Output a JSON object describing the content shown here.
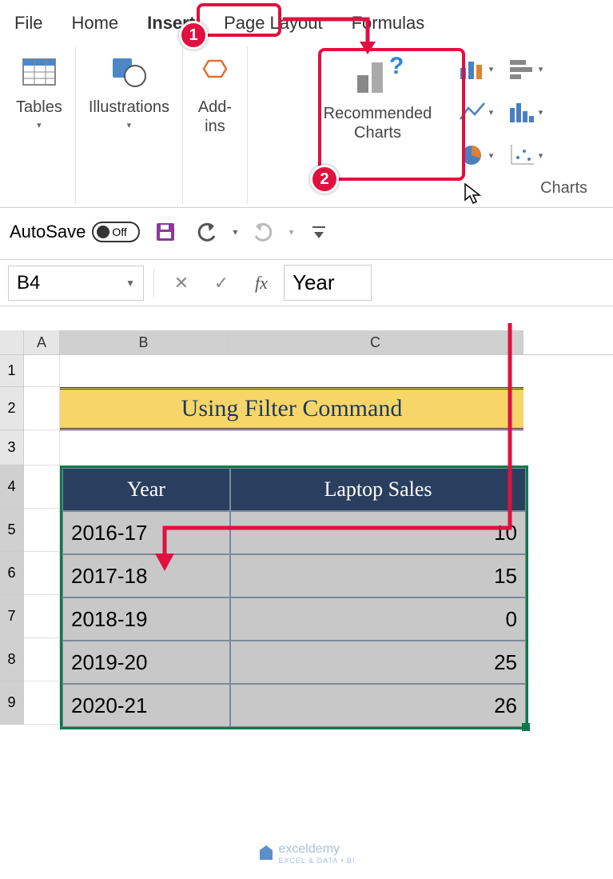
{
  "ribbon": {
    "tabs": [
      "File",
      "Home",
      "Insert",
      "Page Layout",
      "Formulas"
    ],
    "active_tab": "Insert",
    "groups": {
      "tables": "Tables",
      "illustrations": "Illustrations",
      "addins": "Add-\nins",
      "recommended_charts": "Recommended\nCharts",
      "charts_label": "Charts"
    }
  },
  "qat": {
    "autosave_label": "AutoSave",
    "autosave_state": "Off"
  },
  "formula_bar": {
    "name_box": "B4",
    "formula": "Year"
  },
  "columns": [
    "A",
    "B",
    "C"
  ],
  "row_numbers": [
    "1",
    "2",
    "3",
    "4",
    "5",
    "6",
    "7",
    "8",
    "9"
  ],
  "title": "Using Filter Command",
  "table": {
    "headers": [
      "Year",
      "Laptop Sales"
    ],
    "rows": [
      {
        "year": "2016-17",
        "sales": "10"
      },
      {
        "year": "2017-18",
        "sales": "15"
      },
      {
        "year": "2018-19",
        "sales": "0"
      },
      {
        "year": "2019-20",
        "sales": "25"
      },
      {
        "year": "2020-21",
        "sales": "26"
      }
    ]
  },
  "chart_data": {
    "type": "table",
    "title": "Using Filter Command",
    "categories": [
      "2016-17",
      "2017-18",
      "2018-19",
      "2019-20",
      "2020-21"
    ],
    "series": [
      {
        "name": "Laptop Sales",
        "values": [
          10,
          15,
          0,
          25,
          26
        ]
      }
    ]
  },
  "callouts": {
    "badge1": "1",
    "badge2": "2"
  },
  "watermark": {
    "text": "exceldemy",
    "sub": "EXCEL & DATA • BI"
  }
}
